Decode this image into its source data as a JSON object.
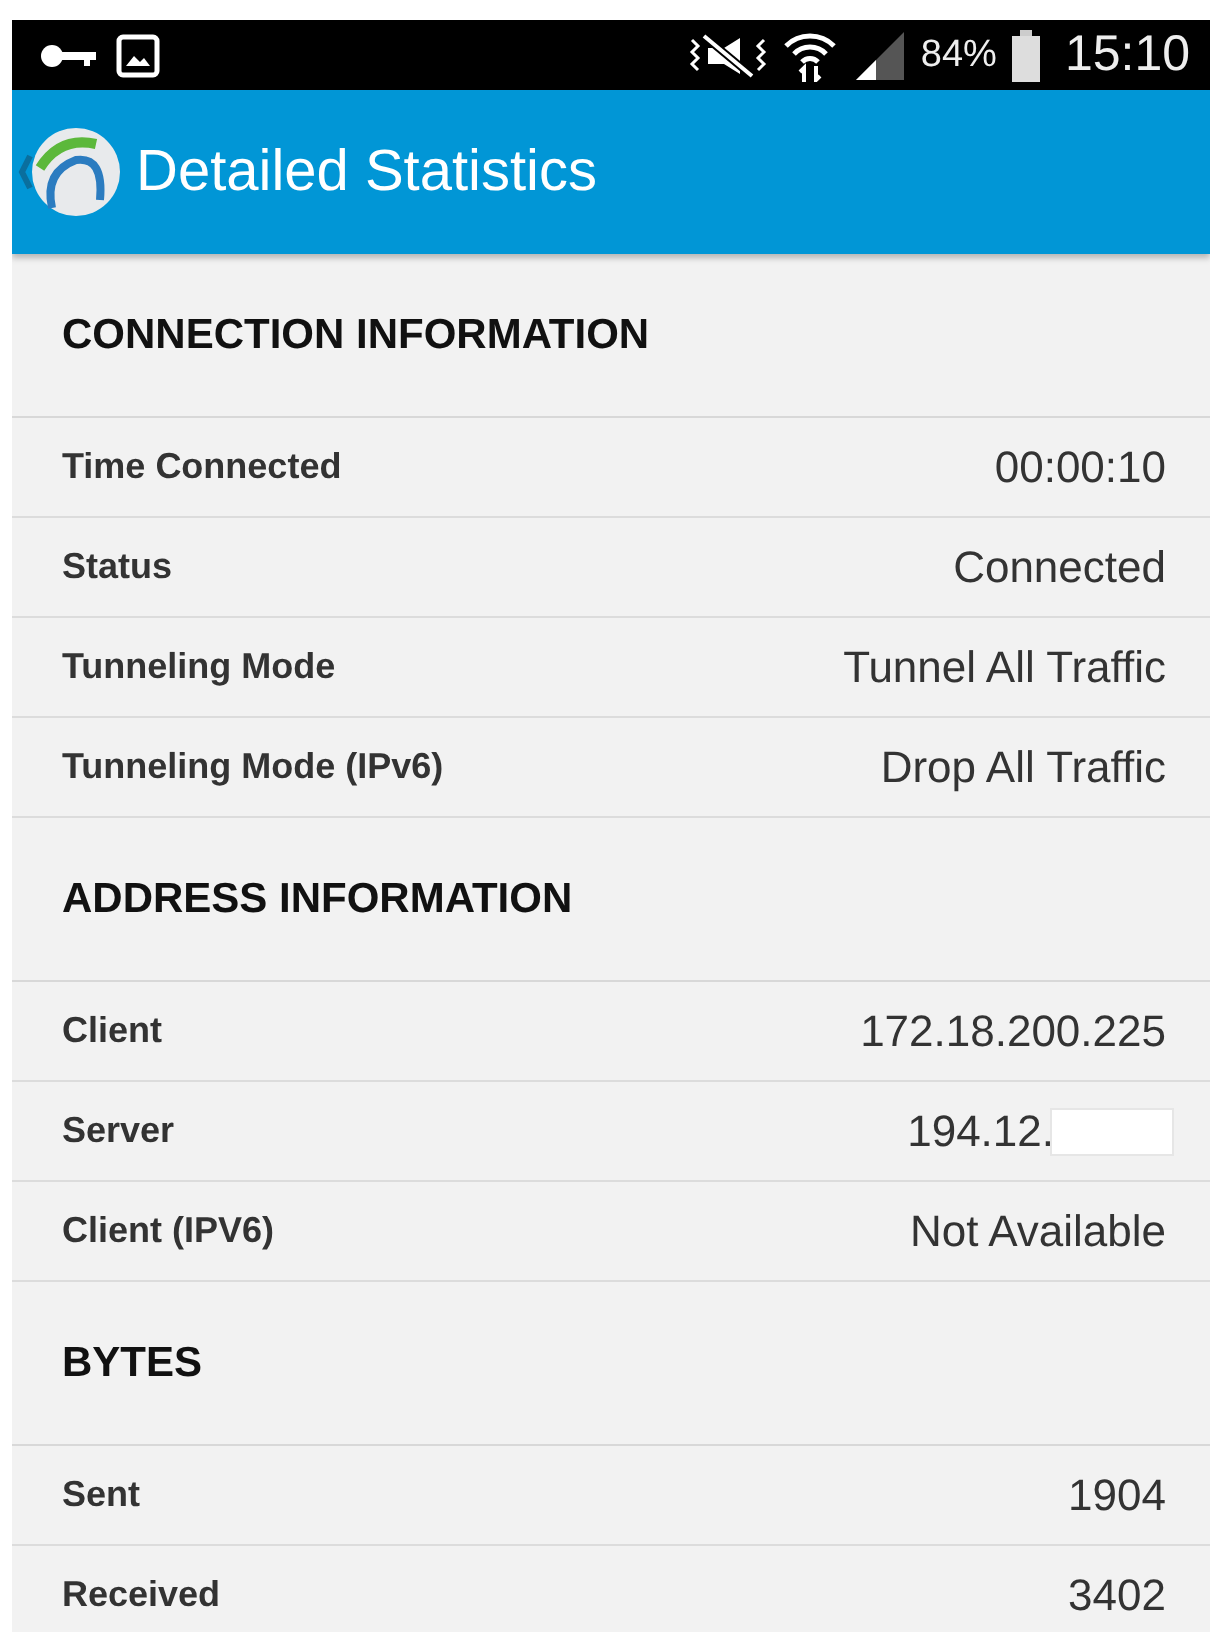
{
  "status_bar": {
    "battery": "84%",
    "time": "15:10"
  },
  "app_bar": {
    "title": "Detailed Statistics"
  },
  "sections": [
    {
      "title": "CONNECTION INFORMATION",
      "rows": [
        {
          "label": "Time Connected",
          "value": "00:00:10"
        },
        {
          "label": "Status",
          "value": "Connected"
        },
        {
          "label": "Tunneling Mode",
          "value": "Tunnel All Traffic"
        },
        {
          "label": "Tunneling Mode (IPv6)",
          "value": "Drop All Traffic"
        }
      ]
    },
    {
      "title": "ADDRESS INFORMATION",
      "rows": [
        {
          "label": "Client",
          "value": "172.18.200.225"
        },
        {
          "label": "Server",
          "value": "194.12.",
          "redacted": true
        },
        {
          "label": "Client (IPV6)",
          "value": "Not Available"
        }
      ]
    },
    {
      "title": "BYTES",
      "rows": [
        {
          "label": "Sent",
          "value": "1904"
        },
        {
          "label": "Received",
          "value": "3402"
        }
      ]
    }
  ]
}
